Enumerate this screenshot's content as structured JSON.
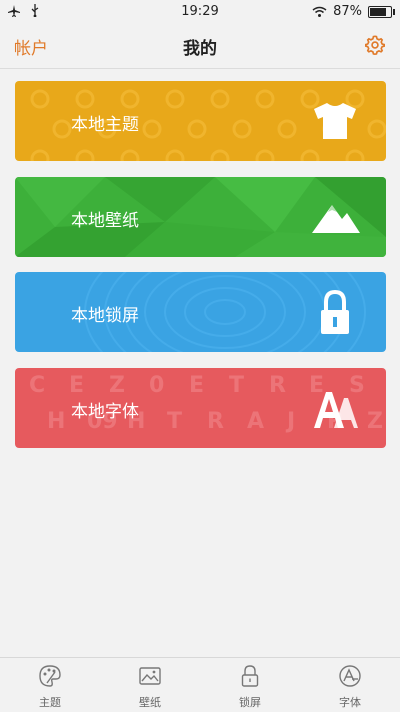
{
  "status": {
    "time": "19:29",
    "battery": "87%",
    "battery_level": 0.87
  },
  "header": {
    "left": "帐户",
    "title": "我的",
    "settings_icon": "gear-icon"
  },
  "cards": [
    {
      "label": "本地主题",
      "color": "#e8a81a",
      "icon": "tshirt-icon"
    },
    {
      "label": "本地壁纸",
      "color": "#3db03a",
      "icon": "mountain-icon"
    },
    {
      "label": "本地锁屏",
      "color": "#3aa3e3",
      "icon": "lock-icon"
    },
    {
      "label": "本地字体",
      "color": "#e65a5e",
      "icon": "font-icon"
    }
  ],
  "card_decor": {
    "font_letters": [
      "C",
      "E",
      "Z",
      "0",
      "E",
      "T",
      "R",
      "E",
      "S",
      "H",
      "09",
      "H",
      "T",
      "R",
      "A",
      "J",
      "R",
      "Z"
    ]
  },
  "tabs": [
    {
      "label": "主题",
      "icon": "palette-icon"
    },
    {
      "label": "壁纸",
      "icon": "picture-icon"
    },
    {
      "label": "锁屏",
      "icon": "lock-icon"
    },
    {
      "label": "字体",
      "icon": "font-icon"
    }
  ],
  "accent": "#e07a2a"
}
